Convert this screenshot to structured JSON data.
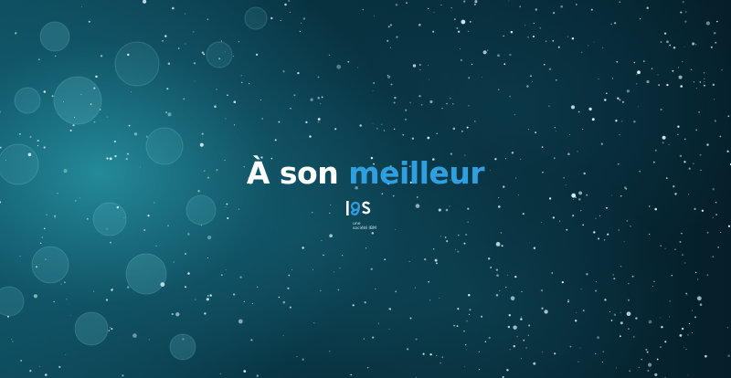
{
  "headline": {
    "part1": "À son",
    "part2": "meilleur"
  },
  "logo": {
    "mark": "lgs",
    "tagline_line1": "une",
    "tagline_line2": "société IBM"
  },
  "colors": {
    "accent": "#2f9fe0",
    "text": "#ffffff",
    "background": "#062836"
  },
  "icons": [
    "lgs-logo-icon"
  ]
}
